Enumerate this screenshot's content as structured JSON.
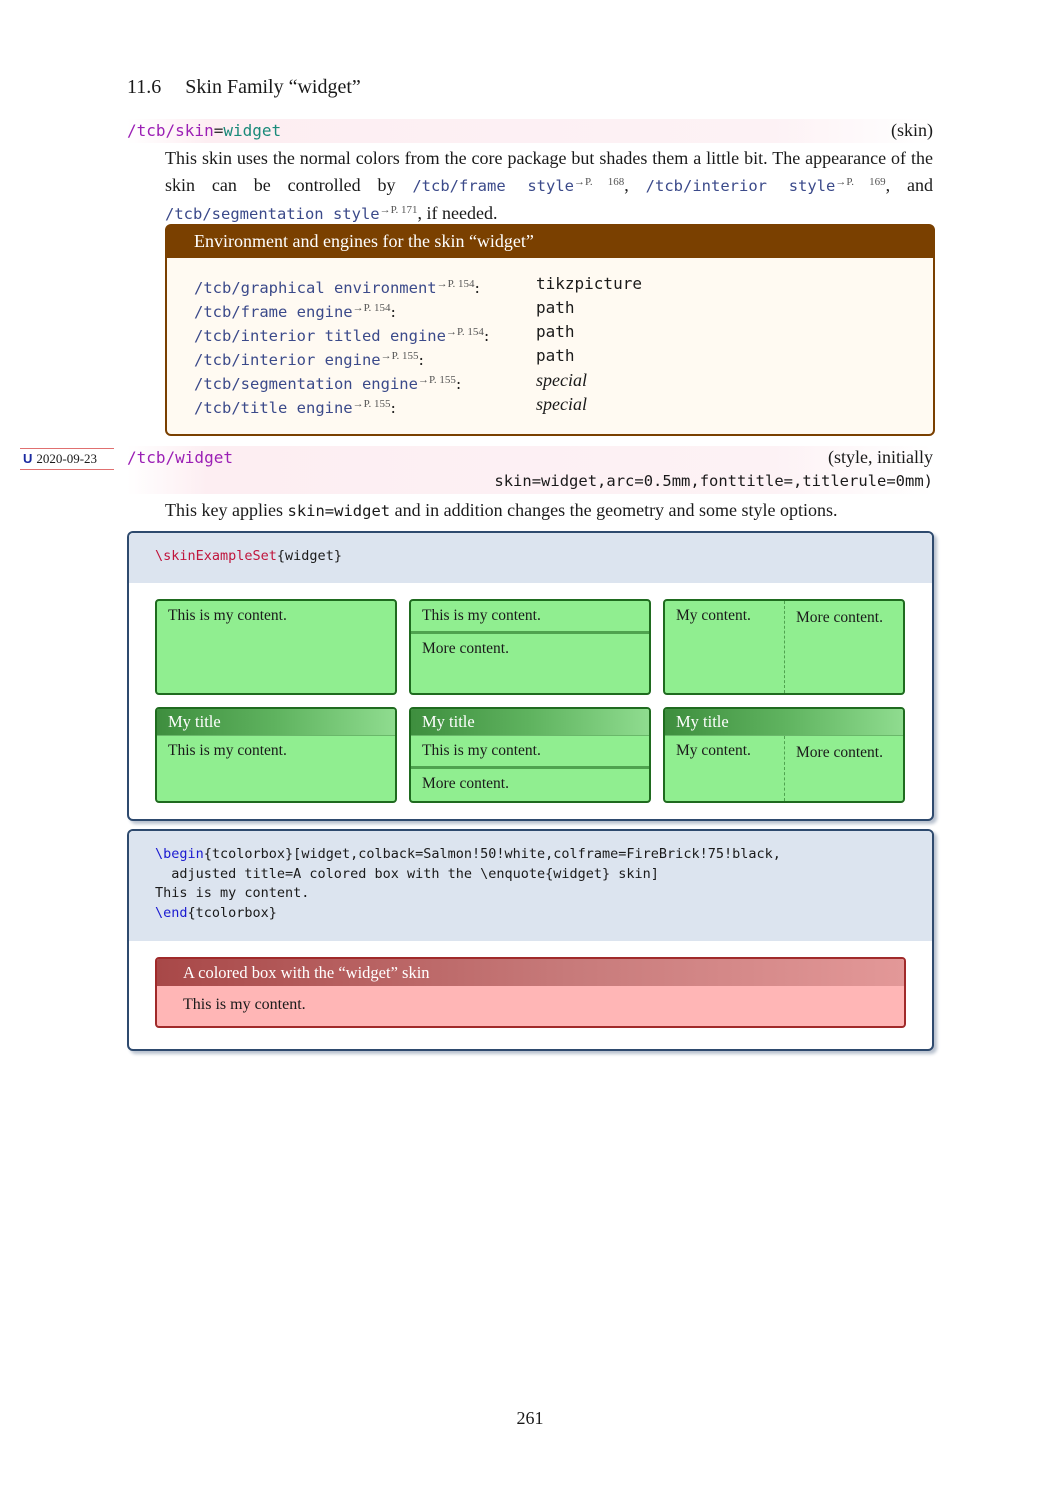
{
  "section": {
    "number": "11.6",
    "title": "Skin Family “widget”"
  },
  "skin_key": {
    "prefix": "/tcb/skin",
    "eq": "=",
    "value": "widget",
    "type": "(skin)",
    "desc": {
      "t1": "This skin uses the normal colors from the core package but shades them a little bit. The appearance of the skin can be controlled by ",
      "l1": "/tcb/frame style",
      "r1": "→P. 168",
      "t2": ", ",
      "l2": "/tcb/interior style",
      "r2": "→P. 169",
      "t3": ", and ",
      "l3": "/tcb/segmentation style",
      "r3": "→P. 171",
      "t4": ", if needed."
    }
  },
  "env_box": {
    "title": "Environment and engines for the skin “widget”",
    "rows": [
      {
        "key": "/tcb/graphical environment",
        "ref": "→P. 154",
        "value": "tikzpicture",
        "style": "tt"
      },
      {
        "key": "/tcb/frame engine",
        "ref": "→P. 154",
        "value": "path",
        "style": "tt"
      },
      {
        "key": "/tcb/interior titled engine",
        "ref": "→P. 154",
        "value": "path",
        "style": "tt"
      },
      {
        "key": "/tcb/interior engine",
        "ref": "→P. 155",
        "value": "path",
        "style": "tt"
      },
      {
        "key": "/tcb/segmentation engine",
        "ref": "→P. 155",
        "value": "special",
        "style": "it"
      },
      {
        "key": "/tcb/title engine",
        "ref": "→P. 155",
        "value": "special",
        "style": "it"
      }
    ]
  },
  "update_badge": {
    "letter": "U",
    "date": "2020-09-23"
  },
  "widget_key": {
    "name": "/tcb/widget",
    "type_line1": "(style, initially",
    "type_line2": "skin=widget,arc=0.5mm,fonttitle=,titlerule=0mm)",
    "desc_pre": "This key applies ",
    "desc_code": "skin=widget",
    "desc_post": " and in addition changes the geometry and some style options."
  },
  "example1": {
    "code_cmd": "\\skinExampleSet",
    "code_arg": "{widget}",
    "boxes": [
      {
        "title": "",
        "content": "This is my content.",
        "lower": "",
        "layout": "plain"
      },
      {
        "title": "",
        "content": "This is my content.",
        "lower": "More content.",
        "layout": "segmented"
      },
      {
        "title": "",
        "content": "My content.",
        "lower": "More content.",
        "layout": "sidebyside"
      },
      {
        "title": "My title",
        "content": "This is my content.",
        "lower": "",
        "layout": "plain"
      },
      {
        "title": "My title",
        "content": "This is my content.",
        "lower": "More content.",
        "layout": "segmented"
      },
      {
        "title": "My title",
        "content": "My content.",
        "lower": "More content.",
        "layout": "sidebyside"
      }
    ]
  },
  "example2": {
    "code": {
      "begin": "\\begin",
      "l1_rest": "{tcolorbox}[widget,colback=Salmon!50!white,colframe=FireBrick!75!black,",
      "l2": "  adjusted title=A colored box with the \\enquote{widget} skin]",
      "l3": "This is my content.",
      "end": "\\end",
      "l4_rest": "{tcolorbox}"
    },
    "box_title": "A colored box with the “widget” skin",
    "box_content": "This is my content."
  },
  "page_number": "261"
}
